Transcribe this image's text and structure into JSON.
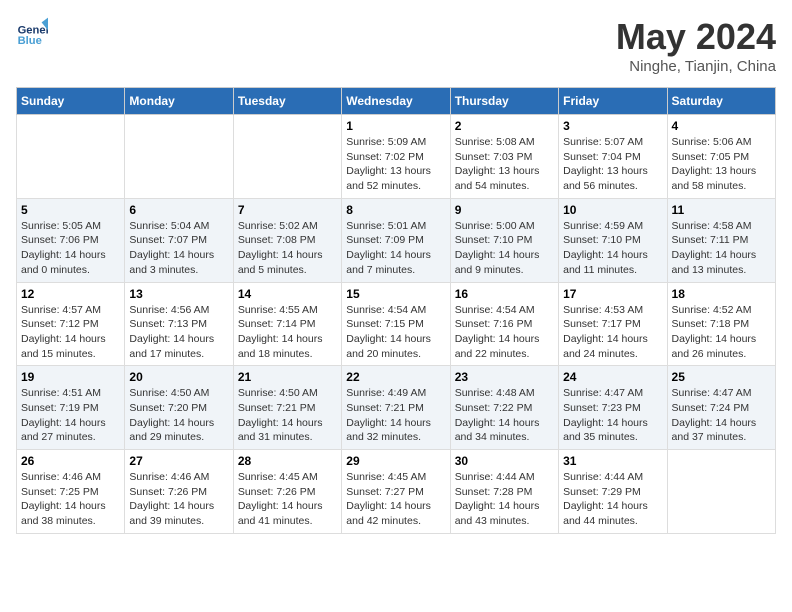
{
  "header": {
    "logo_general": "General",
    "logo_blue": "Blue",
    "title": "May 2024",
    "location": "Ninghe, Tianjin, China"
  },
  "days_of_week": [
    "Sunday",
    "Monday",
    "Tuesday",
    "Wednesday",
    "Thursday",
    "Friday",
    "Saturday"
  ],
  "weeks": [
    [
      {
        "day": "",
        "info": ""
      },
      {
        "day": "",
        "info": ""
      },
      {
        "day": "",
        "info": ""
      },
      {
        "day": "1",
        "info": "Sunrise: 5:09 AM\nSunset: 7:02 PM\nDaylight: 13 hours and 52 minutes."
      },
      {
        "day": "2",
        "info": "Sunrise: 5:08 AM\nSunset: 7:03 PM\nDaylight: 13 hours and 54 minutes."
      },
      {
        "day": "3",
        "info": "Sunrise: 5:07 AM\nSunset: 7:04 PM\nDaylight: 13 hours and 56 minutes."
      },
      {
        "day": "4",
        "info": "Sunrise: 5:06 AM\nSunset: 7:05 PM\nDaylight: 13 hours and 58 minutes."
      }
    ],
    [
      {
        "day": "5",
        "info": "Sunrise: 5:05 AM\nSunset: 7:06 PM\nDaylight: 14 hours and 0 minutes."
      },
      {
        "day": "6",
        "info": "Sunrise: 5:04 AM\nSunset: 7:07 PM\nDaylight: 14 hours and 3 minutes."
      },
      {
        "day": "7",
        "info": "Sunrise: 5:02 AM\nSunset: 7:08 PM\nDaylight: 14 hours and 5 minutes."
      },
      {
        "day": "8",
        "info": "Sunrise: 5:01 AM\nSunset: 7:09 PM\nDaylight: 14 hours and 7 minutes."
      },
      {
        "day": "9",
        "info": "Sunrise: 5:00 AM\nSunset: 7:10 PM\nDaylight: 14 hours and 9 minutes."
      },
      {
        "day": "10",
        "info": "Sunrise: 4:59 AM\nSunset: 7:10 PM\nDaylight: 14 hours and 11 minutes."
      },
      {
        "day": "11",
        "info": "Sunrise: 4:58 AM\nSunset: 7:11 PM\nDaylight: 14 hours and 13 minutes."
      }
    ],
    [
      {
        "day": "12",
        "info": "Sunrise: 4:57 AM\nSunset: 7:12 PM\nDaylight: 14 hours and 15 minutes."
      },
      {
        "day": "13",
        "info": "Sunrise: 4:56 AM\nSunset: 7:13 PM\nDaylight: 14 hours and 17 minutes."
      },
      {
        "day": "14",
        "info": "Sunrise: 4:55 AM\nSunset: 7:14 PM\nDaylight: 14 hours and 18 minutes."
      },
      {
        "day": "15",
        "info": "Sunrise: 4:54 AM\nSunset: 7:15 PM\nDaylight: 14 hours and 20 minutes."
      },
      {
        "day": "16",
        "info": "Sunrise: 4:54 AM\nSunset: 7:16 PM\nDaylight: 14 hours and 22 minutes."
      },
      {
        "day": "17",
        "info": "Sunrise: 4:53 AM\nSunset: 7:17 PM\nDaylight: 14 hours and 24 minutes."
      },
      {
        "day": "18",
        "info": "Sunrise: 4:52 AM\nSunset: 7:18 PM\nDaylight: 14 hours and 26 minutes."
      }
    ],
    [
      {
        "day": "19",
        "info": "Sunrise: 4:51 AM\nSunset: 7:19 PM\nDaylight: 14 hours and 27 minutes."
      },
      {
        "day": "20",
        "info": "Sunrise: 4:50 AM\nSunset: 7:20 PM\nDaylight: 14 hours and 29 minutes."
      },
      {
        "day": "21",
        "info": "Sunrise: 4:50 AM\nSunset: 7:21 PM\nDaylight: 14 hours and 31 minutes."
      },
      {
        "day": "22",
        "info": "Sunrise: 4:49 AM\nSunset: 7:21 PM\nDaylight: 14 hours and 32 minutes."
      },
      {
        "day": "23",
        "info": "Sunrise: 4:48 AM\nSunset: 7:22 PM\nDaylight: 14 hours and 34 minutes."
      },
      {
        "day": "24",
        "info": "Sunrise: 4:47 AM\nSunset: 7:23 PM\nDaylight: 14 hours and 35 minutes."
      },
      {
        "day": "25",
        "info": "Sunrise: 4:47 AM\nSunset: 7:24 PM\nDaylight: 14 hours and 37 minutes."
      }
    ],
    [
      {
        "day": "26",
        "info": "Sunrise: 4:46 AM\nSunset: 7:25 PM\nDaylight: 14 hours and 38 minutes."
      },
      {
        "day": "27",
        "info": "Sunrise: 4:46 AM\nSunset: 7:26 PM\nDaylight: 14 hours and 39 minutes."
      },
      {
        "day": "28",
        "info": "Sunrise: 4:45 AM\nSunset: 7:26 PM\nDaylight: 14 hours and 41 minutes."
      },
      {
        "day": "29",
        "info": "Sunrise: 4:45 AM\nSunset: 7:27 PM\nDaylight: 14 hours and 42 minutes."
      },
      {
        "day": "30",
        "info": "Sunrise: 4:44 AM\nSunset: 7:28 PM\nDaylight: 14 hours and 43 minutes."
      },
      {
        "day": "31",
        "info": "Sunrise: 4:44 AM\nSunset: 7:29 PM\nDaylight: 14 hours and 44 minutes."
      },
      {
        "day": "",
        "info": ""
      }
    ]
  ]
}
